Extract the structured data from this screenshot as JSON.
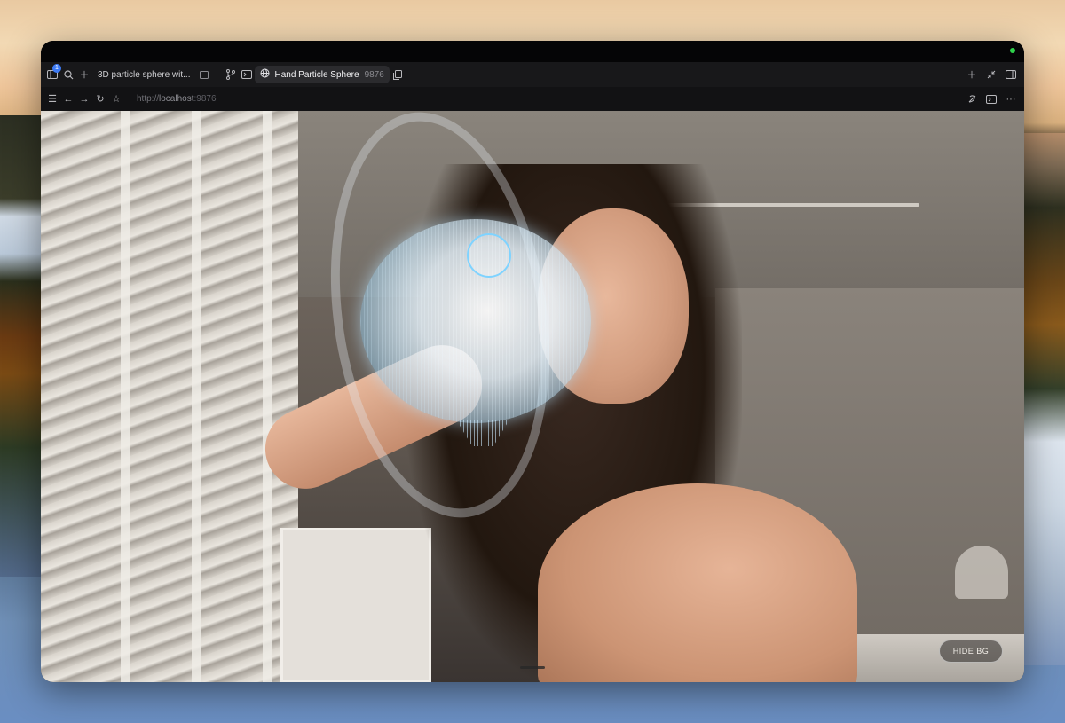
{
  "browser": {
    "sidebar_badge": "1",
    "tabs": [
      {
        "label": "3D particle sphere wit...",
        "active": false
      },
      {
        "label": "Hand Particle Sphere",
        "port": "9876",
        "active": true
      }
    ],
    "url": {
      "scheme": "http://",
      "host": "localhost",
      "port": ":9876"
    }
  },
  "icons": {
    "sidebar": "sidebar-icon",
    "search": "search-icon",
    "new_tab": "plus-icon",
    "tab_close": "tab-minus-icon",
    "branch": "branch-icon",
    "terminal": "terminal-icon",
    "globe": "globe-icon",
    "copy": "copy-icon",
    "back": "back-icon",
    "forward": "forward-icon",
    "reload": "reload-icon",
    "bookmark": "star-icon",
    "more": "more-icon"
  },
  "app": {
    "hide_bg_label": "HIDE BG"
  },
  "colors": {
    "accent": "#3d7bf6",
    "status_green": "#2fd14b",
    "hand_cursor": "#7fd3ff"
  }
}
